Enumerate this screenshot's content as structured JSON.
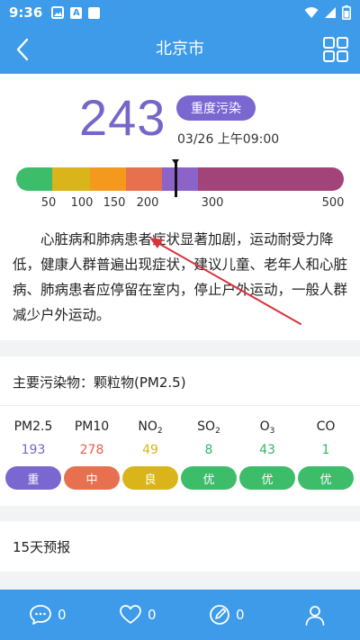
{
  "status": {
    "time": "9:36"
  },
  "header": {
    "title": "北京市"
  },
  "aqi": {
    "value": "243",
    "level": "重度污染",
    "update_time": "03/26 上午09:00",
    "scale_ticks": [
      "50",
      "100",
      "150",
      "200",
      "300",
      "500"
    ],
    "scale_colors": [
      "#3dbd6a",
      "#d9b41a",
      "#f39a1e",
      "#e7704e",
      "#8c63c9",
      "#a2447a"
    ],
    "marker_value": 243,
    "advice": "心脏病和肺病患者症状显著加剧，运动耐受力降低，健康人群普遍出现症状，建议儿童、老年人和心脏病、肺病患者应停留在室内，停止户外运动，一般人群减少户外运动。"
  },
  "pollutants": {
    "primary": "主要污染物：颗粒物(PM2.5)",
    "items": [
      {
        "name": "PM2.5",
        "sub": "",
        "value": "193",
        "grade": "重",
        "value_color": "#7566c9",
        "badge_color": "#7a67cf"
      },
      {
        "name": "PM10",
        "sub": "",
        "value": "278",
        "grade": "中",
        "value_color": "#e5604a",
        "badge_color": "#e7704e"
      },
      {
        "name": "NO",
        "sub": "2",
        "value": "49",
        "grade": "良",
        "value_color": "#d9b41a",
        "badge_color": "#d9b41a"
      },
      {
        "name": "SO",
        "sub": "2",
        "value": "8",
        "grade": "优",
        "value_color": "#2fb865",
        "badge_color": "#3dbd6a"
      },
      {
        "name": "O",
        "sub": "3",
        "value": "43",
        "grade": "优",
        "value_color": "#2fb865",
        "badge_color": "#3dbd6a"
      },
      {
        "name": "CO",
        "sub": "",
        "value": "1",
        "grade": "优",
        "value_color": "#2fb865",
        "badge_color": "#3dbd6a"
      }
    ]
  },
  "forecast": {
    "label": "15天预报"
  },
  "tabbar": {
    "comments_count": "0",
    "likes_count": "0",
    "shares_count": "0"
  }
}
